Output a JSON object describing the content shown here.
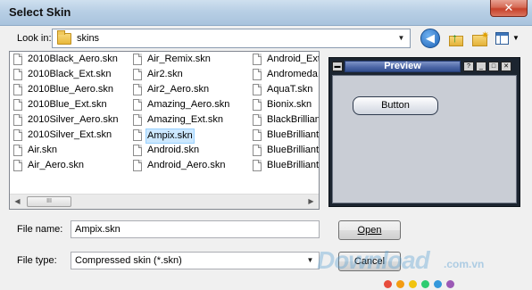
{
  "window": {
    "title": "Select Skin",
    "close_label": "✕"
  },
  "lookin": {
    "label": "Look in:",
    "value": "skins"
  },
  "files": {
    "col1": [
      "2010Black_Aero.skn",
      "2010Black_Ext.skn",
      "2010Blue_Aero.skn",
      "2010Blue_Ext.skn",
      "2010Silver_Aero.skn",
      "2010Silver_Ext.skn",
      "Air.skn",
      "Air_Aero.skn"
    ],
    "col2": [
      "Air_Remix.skn",
      "Air2.skn",
      "Air2_Aero.skn",
      "Amazing_Aero.skn",
      "Amazing_Ext.skn",
      "Ampix.skn",
      "Android.skn",
      "Android_Aero.skn"
    ],
    "col3": [
      "Android_Ext",
      "Andromeda.",
      "AquaT.skn",
      "Bionix.skn",
      "BlackBrilliant",
      "BlueBrilliant.",
      "BlueBrilliant.",
      "BlueBrilliant_"
    ],
    "selected": "Ampix.skn",
    "scroll_thumb_glyph": "III"
  },
  "preview": {
    "title": "Preview",
    "button_label": "Button"
  },
  "form": {
    "filename_label": "File name:",
    "filename_value": "Ampix.skn",
    "filetype_label": "File type:",
    "filetype_value": "Compressed skin (*.skn)",
    "open_label": "Open",
    "cancel_label": "Cancel"
  },
  "watermark": {
    "text": "Download",
    "suffix": ".com.vn"
  },
  "colors": {
    "titlebar": "#b8cfe5",
    "selection": "#cce8ff",
    "preview_title": "#4a64a5"
  }
}
